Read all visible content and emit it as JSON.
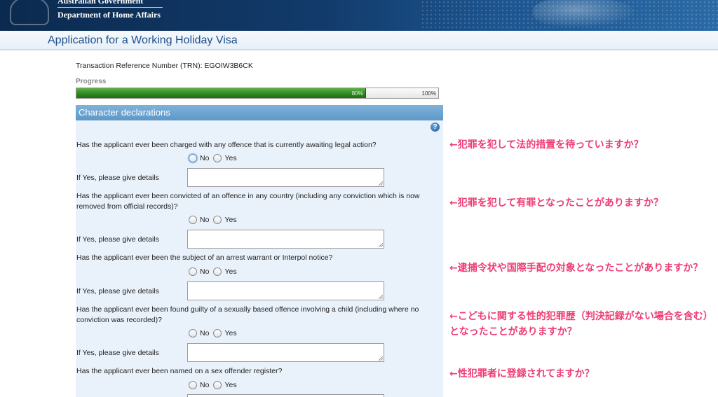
{
  "gov": {
    "line1": "Australian Government",
    "line2": "Department of Home Affairs"
  },
  "page_title": "Application for a Working Holiday Visa",
  "trn": "Transaction Reference Number (TRN): EGOIW3B6CK",
  "progress": {
    "label": "Progress",
    "value_percent": 80,
    "current_text": "80%",
    "total_text": "100%"
  },
  "section": {
    "title": "Character declarations",
    "help": "?"
  },
  "answer_options": {
    "no": "No",
    "yes": "Yes"
  },
  "details_label": "If Yes, please give details",
  "questions": [
    {
      "text": "Has the applicant ever been charged with any offence that is currently awaiting legal action?"
    },
    {
      "text": "Has the applicant ever been convicted of an offence in any country (including any conviction which is now removed from official records)?"
    },
    {
      "text": "Has the applicant ever been the subject of an arrest warrant or Interpol notice?"
    },
    {
      "text": "Has the applicant ever been found guilty of a sexually based offence involving a child (including where no conviction was recorded)?"
    },
    {
      "text": "Has the applicant ever been named on a sex offender register?"
    }
  ],
  "annotations": [
    "←犯罪を犯して法的措置を待っていますか？",
    "←犯罪を犯して有罪となったことがありますか？",
    "←逮捕令状や国際手配の対象となったことがありますか？",
    "←こどもに関する性的犯罪歴（判決記録がない場合を含む）となったことがありますか？",
    "←性犯罪者に登録されてますか？"
  ],
  "colors": {
    "header_dark": "#0b2a4f",
    "title_blue": "#1d4f8a",
    "section_blue": "#5d98c8",
    "progress_green": "#2f8a1f",
    "annotation_pink": "#ee3d74"
  }
}
